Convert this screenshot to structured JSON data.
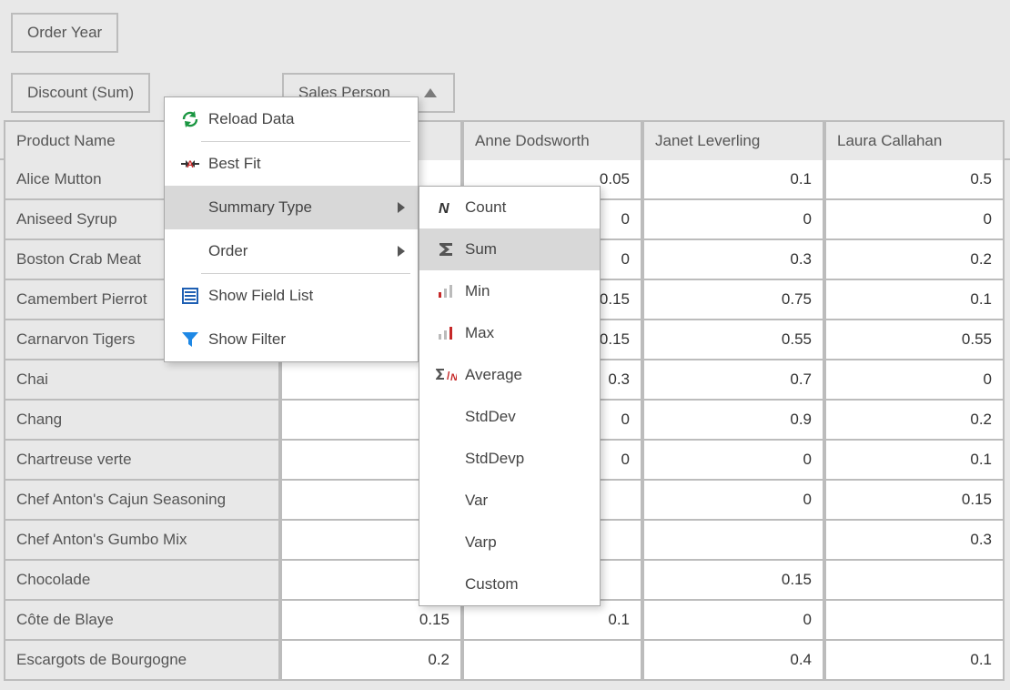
{
  "filter_area": {
    "field": "Order Year"
  },
  "row_area": {
    "field": "Discount (Sum)"
  },
  "column_area": {
    "field": "Sales Person"
  },
  "row_header": "Product Name",
  "column_headers": [
    "",
    "Anne Dodsworth",
    "Janet Leverling",
    "Laura Callahan"
  ],
  "rows": [
    {
      "name": "Alice Mutton",
      "v": [
        "",
        "0.05",
        "0.1",
        "0.5"
      ]
    },
    {
      "name": "Aniseed Syrup",
      "v": [
        "",
        "0",
        "0",
        "0"
      ]
    },
    {
      "name": "Boston Crab Meat",
      "v": [
        "",
        "0",
        "0.3",
        "0.2"
      ]
    },
    {
      "name": "Camembert Pierrot",
      "v": [
        "",
        "0.15",
        "0.75",
        "0.1"
      ]
    },
    {
      "name": "Carnarvon Tigers",
      "v": [
        "",
        "0.15",
        "0.55",
        "0.55"
      ]
    },
    {
      "name": "Chai",
      "v": [
        "",
        "0.3",
        "0.7",
        "0"
      ]
    },
    {
      "name": "Chang",
      "v": [
        "",
        "0",
        "0.9",
        "0.2"
      ]
    },
    {
      "name": "Chartreuse verte",
      "v": [
        "",
        "0",
        "0",
        "0.1"
      ]
    },
    {
      "name": "Chef Anton's Cajun Seasoning",
      "v": [
        "",
        "",
        "0",
        "0.15"
      ]
    },
    {
      "name": "Chef Anton's Gumbo Mix",
      "v": [
        "",
        "",
        "",
        "0.3"
      ]
    },
    {
      "name": "Chocolade",
      "v": [
        "",
        "",
        "0.15",
        ""
      ]
    },
    {
      "name": "Côte de Blaye",
      "v": [
        "0.15",
        "0.1",
        "0",
        ""
      ]
    },
    {
      "name": "Escargots de Bourgogne",
      "v": [
        "0.2",
        "",
        "0.4",
        "0.1"
      ]
    }
  ],
  "context_menu": {
    "items": [
      {
        "icon": "reload-icon",
        "label": "Reload Data"
      },
      {
        "sep": true
      },
      {
        "icon": "bestfit-icon",
        "label": "Best Fit"
      },
      {
        "icon": "",
        "label": "Summary Type",
        "submenu": true,
        "hover": true
      },
      {
        "icon": "",
        "label": "Order",
        "submenu": true
      },
      {
        "sep": true
      },
      {
        "icon": "fieldlist-icon",
        "label": "Show Field List"
      },
      {
        "icon": "filter-icon",
        "label": "Show Filter"
      }
    ]
  },
  "submenu": {
    "items": [
      {
        "icon": "count-icon",
        "label": "Count"
      },
      {
        "icon": "sum-icon",
        "label": "Sum",
        "hover": true
      },
      {
        "icon": "min-icon",
        "label": "Min"
      },
      {
        "icon": "max-icon",
        "label": "Max"
      },
      {
        "icon": "average-icon",
        "label": "Average"
      },
      {
        "icon": "",
        "label": "StdDev"
      },
      {
        "icon": "",
        "label": "StdDevp"
      },
      {
        "icon": "",
        "label": "Var"
      },
      {
        "icon": "",
        "label": "Varp"
      },
      {
        "icon": "",
        "label": "Custom"
      }
    ]
  }
}
